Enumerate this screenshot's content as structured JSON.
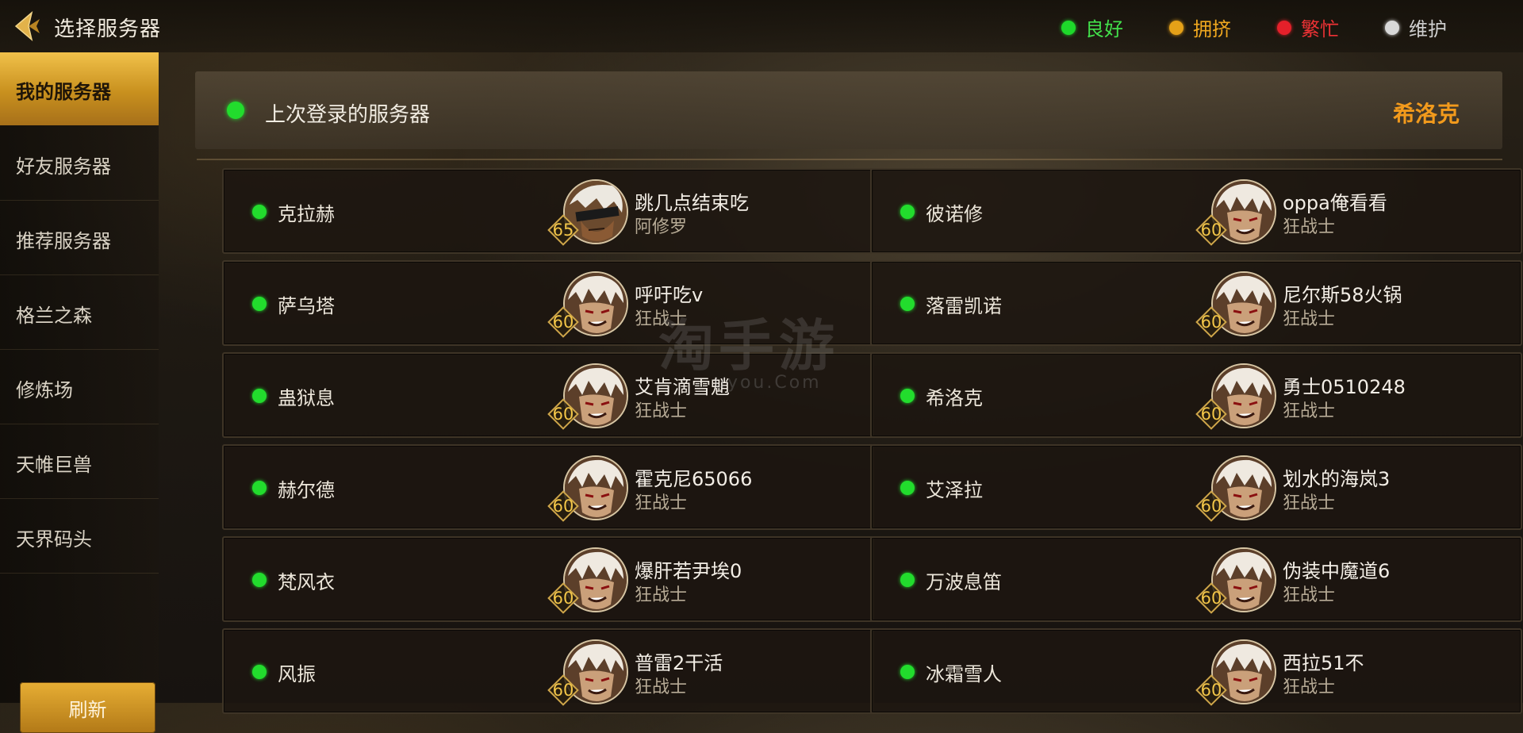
{
  "header": {
    "title": "选择服务器"
  },
  "legend": [
    {
      "label": "良好",
      "color": "#1ed92b",
      "text_color": "#42e04b"
    },
    {
      "label": "拥挤",
      "color": "#e5a118",
      "text_color": "#f0a81f"
    },
    {
      "label": "繁忙",
      "color": "#e4202a",
      "text_color": "#ef3235"
    },
    {
      "label": "维护",
      "color": "#d8d8d8",
      "text_color": "#cfcfcf"
    }
  ],
  "sidebar": {
    "items": [
      {
        "label": "我的服务器",
        "active": true
      },
      {
        "label": "好友服务器"
      },
      {
        "label": "推荐服务器"
      },
      {
        "label": "格兰之森"
      },
      {
        "label": "修炼场"
      },
      {
        "label": "天帷巨兽"
      },
      {
        "label": "天界码头"
      }
    ],
    "refresh_label": "刷新"
  },
  "last_login": {
    "label": "上次登录的服务器",
    "server": "希洛克",
    "status_color": "#22dc2d"
  },
  "servers": [
    {
      "name": "克拉赫",
      "char": "跳几点结束吃",
      "class": "阿修罗",
      "level": "65",
      "avatar": "asura"
    },
    {
      "name": "彼诺修",
      "char": "oppa俺看看",
      "class": "狂战士",
      "level": "60",
      "avatar": "berserker"
    },
    {
      "name": "萨乌塔",
      "char": "呼吁吃v",
      "class": "狂战士",
      "level": "60",
      "avatar": "berserker"
    },
    {
      "name": "落雷凯诺",
      "char": "尼尔斯58火锅",
      "class": "狂战士",
      "level": "60",
      "avatar": "berserker"
    },
    {
      "name": "蛊狱息",
      "char": "艾肯滴雪魈",
      "class": "狂战士",
      "level": "60",
      "avatar": "berserker"
    },
    {
      "name": "希洛克",
      "char": "勇士0510248",
      "class": "狂战士",
      "level": "60",
      "avatar": "berserker"
    },
    {
      "name": "赫尔德",
      "char": "霍克尼65066",
      "class": "狂战士",
      "level": "60",
      "avatar": "berserker"
    },
    {
      "name": "艾泽拉",
      "char": "划水的海岚3",
      "class": "狂战士",
      "level": "60",
      "avatar": "berserker"
    },
    {
      "name": "梵风衣",
      "char": "爆肝若尹埃0",
      "class": "狂战士",
      "level": "60",
      "avatar": "berserker"
    },
    {
      "name": "万波息笛",
      "char": "伪装中魔道6",
      "class": "狂战士",
      "level": "60",
      "avatar": "berserker"
    },
    {
      "name": "风振",
      "char": "普雷2干活",
      "class": "狂战士",
      "level": "60",
      "avatar": "berserker"
    },
    {
      "name": "冰霜雪人",
      "char": "西拉51不",
      "class": "狂战士",
      "level": "60",
      "avatar": "berserker"
    }
  ],
  "watermark": {
    "main": "淘手游",
    "sub": "uyou.Com"
  }
}
